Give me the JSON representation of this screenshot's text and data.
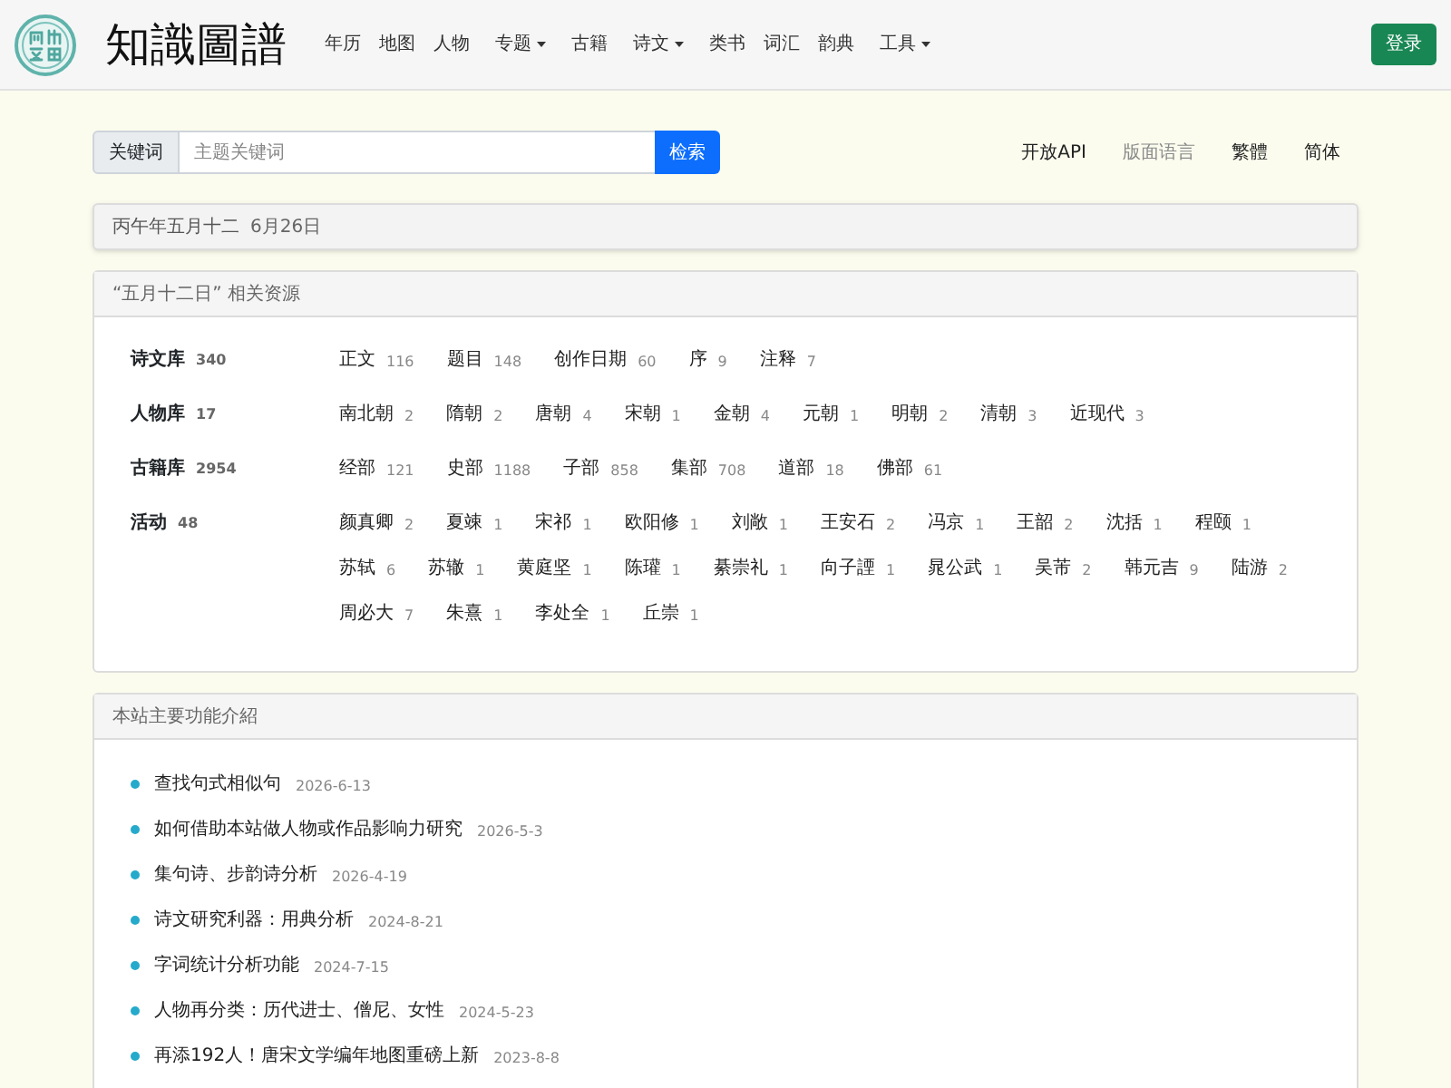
{
  "navbar": {
    "title": "知識圖譜",
    "items": [
      {
        "label": "年历",
        "dropdown": false
      },
      {
        "label": "地图",
        "dropdown": false
      },
      {
        "label": "人物",
        "dropdown": false
      },
      {
        "label": "专题",
        "dropdown": true
      },
      {
        "label": "古籍",
        "dropdown": false
      },
      {
        "label": "诗文",
        "dropdown": true
      },
      {
        "label": "类书",
        "dropdown": false
      },
      {
        "label": "词汇",
        "dropdown": false
      },
      {
        "label": "韵典",
        "dropdown": false
      },
      {
        "label": "工具",
        "dropdown": true
      }
    ],
    "login_button": "登录"
  },
  "search": {
    "addon": "关键词",
    "placeholder": "主题关键词",
    "button": "检索"
  },
  "top_links": [
    {
      "label": "开放API",
      "disabled": false
    },
    {
      "label": "版面语言",
      "disabled": true
    },
    {
      "label": "繁體",
      "disabled": false
    },
    {
      "label": "简体",
      "disabled": false
    }
  ],
  "date_card": {
    "lunar_date": "丙午年五月十二",
    "solar_date": "6月26日"
  },
  "resources": {
    "title": "“五月十二日” 相关资源",
    "rows": [
      {
        "label": "诗文库",
        "count": "340",
        "items": [
          {
            "label": "正文",
            "count": "116"
          },
          {
            "label": "题目",
            "count": "148"
          },
          {
            "label": "创作日期",
            "count": "60"
          },
          {
            "label": "序",
            "count": "9"
          },
          {
            "label": "注释",
            "count": "7"
          }
        ]
      },
      {
        "label": "人物库",
        "count": "17",
        "items": [
          {
            "label": "南北朝",
            "count": "2"
          },
          {
            "label": "隋朝",
            "count": "2"
          },
          {
            "label": "唐朝",
            "count": "4"
          },
          {
            "label": "宋朝",
            "count": "1"
          },
          {
            "label": "金朝",
            "count": "4"
          },
          {
            "label": "元朝",
            "count": "1"
          },
          {
            "label": "明朝",
            "count": "2"
          },
          {
            "label": "清朝",
            "count": "3"
          },
          {
            "label": "近现代",
            "count": "3"
          }
        ]
      },
      {
        "label": "古籍库",
        "count": "2954",
        "items": [
          {
            "label": "经部",
            "count": "121"
          },
          {
            "label": "史部",
            "count": "1188"
          },
          {
            "label": "子部",
            "count": "858"
          },
          {
            "label": "集部",
            "count": "708"
          },
          {
            "label": "道部",
            "count": "18"
          },
          {
            "label": "佛部",
            "count": "61"
          }
        ]
      },
      {
        "label": "活动",
        "count": "48",
        "items": [
          {
            "label": "颜真卿",
            "count": "2"
          },
          {
            "label": "夏竦",
            "count": "1"
          },
          {
            "label": "宋祁",
            "count": "1"
          },
          {
            "label": "欧阳修",
            "count": "1"
          },
          {
            "label": "刘敞",
            "count": "1"
          },
          {
            "label": "王安石",
            "count": "2"
          },
          {
            "label": "冯京",
            "count": "1"
          },
          {
            "label": "王韶",
            "count": "2"
          },
          {
            "label": "沈括",
            "count": "1"
          },
          {
            "label": "程颐",
            "count": "1"
          },
          {
            "label": "苏轼",
            "count": "6"
          },
          {
            "label": "苏辙",
            "count": "1"
          },
          {
            "label": "黄庭坚",
            "count": "1"
          },
          {
            "label": "陈瓘",
            "count": "1"
          },
          {
            "label": "綦崇礼",
            "count": "1"
          },
          {
            "label": "向子諲",
            "count": "1"
          },
          {
            "label": "晁公武",
            "count": "1"
          },
          {
            "label": "吴芾",
            "count": "2"
          },
          {
            "label": "韩元吉",
            "count": "9"
          },
          {
            "label": "陆游",
            "count": "2"
          },
          {
            "label": "周必大",
            "count": "7"
          },
          {
            "label": "朱熹",
            "count": "1"
          },
          {
            "label": "李处全",
            "count": "1"
          },
          {
            "label": "丘崇",
            "count": "1"
          }
        ]
      }
    ]
  },
  "features": {
    "title": "本站主要功能介紹",
    "items": [
      {
        "title": "查找句式相似句",
        "date": "2026-6-13"
      },
      {
        "title": "如何借助本站做人物或作品影响力研究",
        "date": "2026-5-3"
      },
      {
        "title": "集句诗、步韵诗分析",
        "date": "2026-4-19"
      },
      {
        "title": "诗文研究利器：用典分析",
        "date": "2024-8-21"
      },
      {
        "title": "字词统计分析功能",
        "date": "2024-7-15"
      },
      {
        "title": "人物再分类：历代进士、僧尼、女性",
        "date": "2024-5-23"
      },
      {
        "title": "再添192人！唐宋文学编年地图重磅上新",
        "date": "2023-8-8"
      }
    ]
  }
}
